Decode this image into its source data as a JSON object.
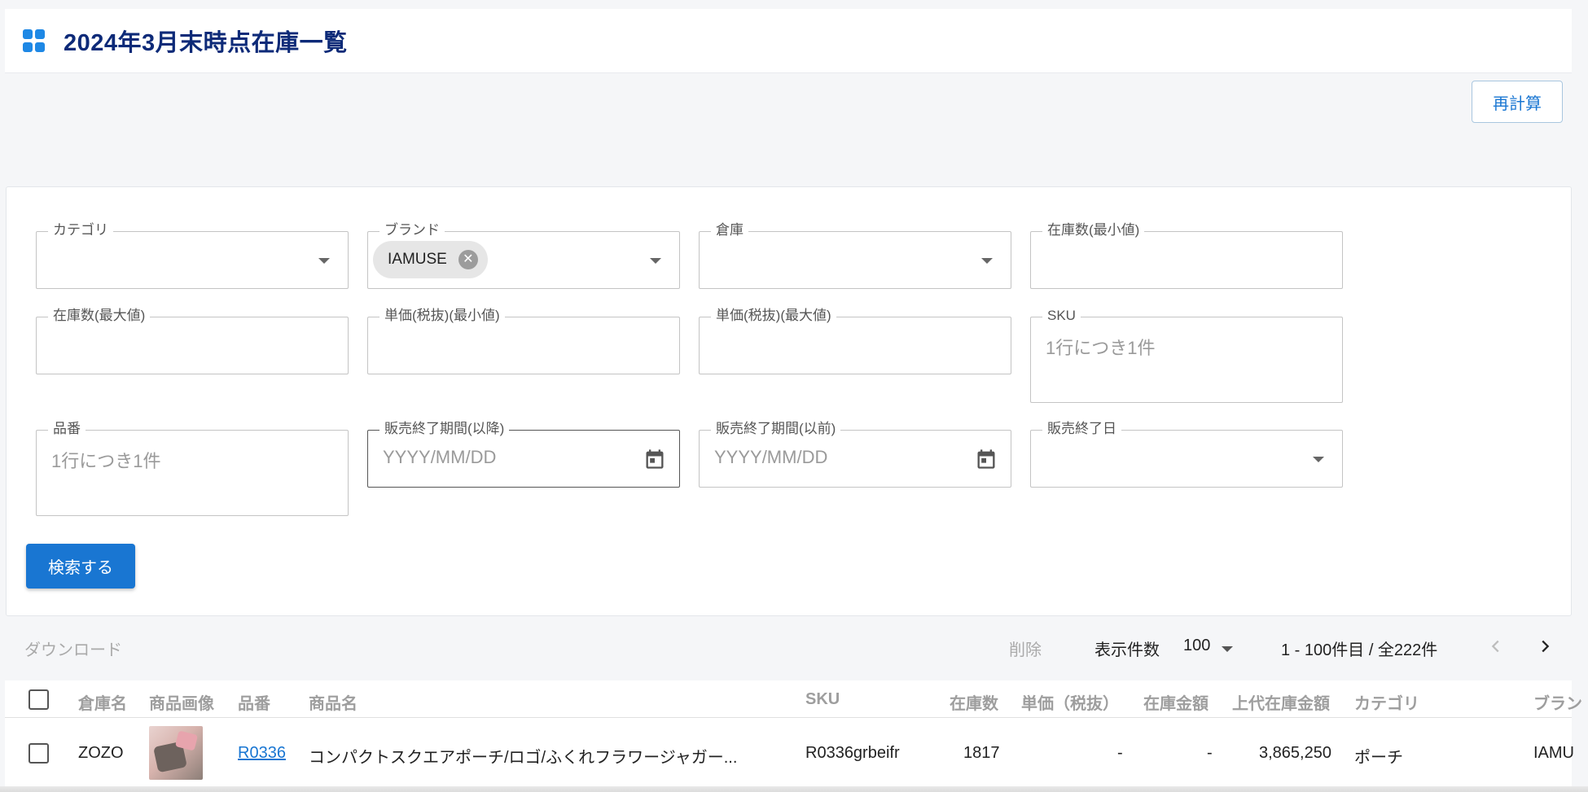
{
  "header": {
    "title": "2024年3月末時点在庫一覧",
    "icon": "grid-icon"
  },
  "actions": {
    "recalc_label": "再計算"
  },
  "filters": {
    "category": {
      "label": "カテゴリ",
      "value": ""
    },
    "brand": {
      "label": "ブランド",
      "chip": "IAMUSE"
    },
    "warehouse": {
      "label": "倉庫",
      "value": ""
    },
    "stock_min": {
      "label": "在庫数(最小値)",
      "value": ""
    },
    "stock_max": {
      "label": "在庫数(最大値)",
      "value": ""
    },
    "price_min": {
      "label": "単価(税抜)(最小値)",
      "value": ""
    },
    "price_max": {
      "label": "単価(税抜)(最大値)",
      "value": ""
    },
    "sku": {
      "label": "SKU",
      "placeholder": "1行につき1件"
    },
    "item_no": {
      "label": "品番",
      "placeholder": "1行につき1件"
    },
    "end_from": {
      "label": "販売終了期間(以降)",
      "placeholder": "YYYY/MM/DD"
    },
    "end_to": {
      "label": "販売終了期間(以前)",
      "placeholder": "YYYY/MM/DD"
    },
    "end_date": {
      "label": "販売終了日",
      "value": ""
    },
    "search_label": "検索する"
  },
  "toolbar": {
    "download_label": "ダウンロード",
    "delete_label": "削除",
    "per_page_label": "表示件数",
    "per_page_value": "100",
    "range_text": "1 - 100件目 / 全222件",
    "prev_icon": "chevron-left-icon",
    "next_icon": "chevron-right-icon"
  },
  "table": {
    "columns": [
      "倉庫名",
      "商品画像",
      "品番",
      "商品名",
      "SKU",
      "在庫数",
      "単価（税抜）",
      "在庫金額",
      "上代在庫金額",
      "カテゴリ",
      "ブラン"
    ],
    "rows": [
      {
        "warehouse": "ZOZO",
        "item_no": "R0336",
        "name": "コンパクトスクエアポーチ/ロゴ/ふくれフラワージャガー...",
        "sku": "R0336grbeifr",
        "stock": "1817",
        "unit_price": "-",
        "stock_amount": "-",
        "retail_amount": "3,865,250",
        "category": "ポーチ",
        "brand": "IAMU"
      }
    ]
  },
  "colors": {
    "accent": "#1976d2",
    "title": "#0d2a78"
  }
}
